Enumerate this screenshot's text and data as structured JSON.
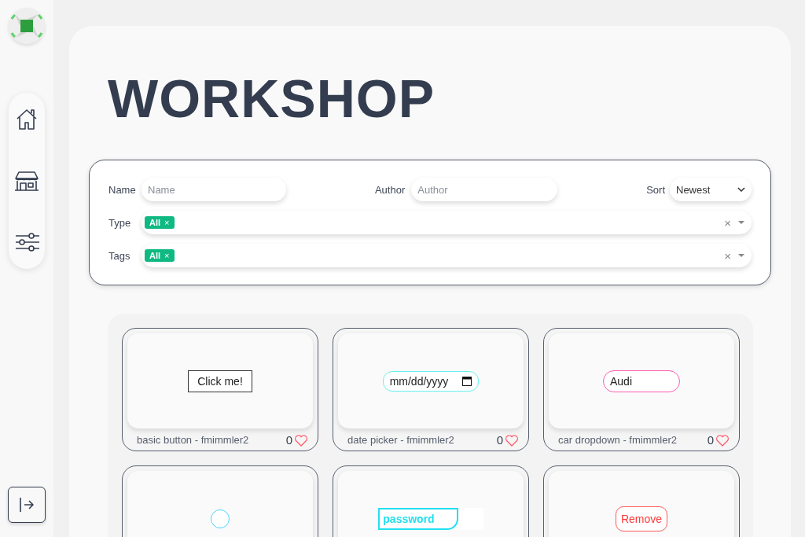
{
  "title": "WORKSHOP",
  "filters": {
    "name": {
      "label": "Name",
      "placeholder": "Name"
    },
    "author": {
      "label": "Author",
      "placeholder": "Author"
    },
    "sort": {
      "label": "Sort",
      "value": "Newest"
    },
    "type": {
      "label": "Type",
      "chips": [
        "All"
      ],
      "chip_remove": "×",
      "clear": "×"
    },
    "tags": {
      "label": "Tags",
      "chips": [
        "All"
      ],
      "chip_remove": "×",
      "clear": "×"
    }
  },
  "cards": [
    {
      "kind": "button",
      "preview_text": "Click me!",
      "caption": "basic button - fmimmler2",
      "likes": "0"
    },
    {
      "kind": "date",
      "preview_text": "mm/dd/yyyy",
      "caption": "date picker - fmimmler2",
      "likes": "0"
    },
    {
      "kind": "dropdown",
      "preview_text": "Audi",
      "caption": "car dropdown - fmimmler2",
      "likes": "0"
    },
    {
      "kind": "radio",
      "checked": false
    },
    {
      "kind": "password",
      "preview_text": "password"
    },
    {
      "kind": "remove",
      "preview_text": "Remove"
    }
  ]
}
